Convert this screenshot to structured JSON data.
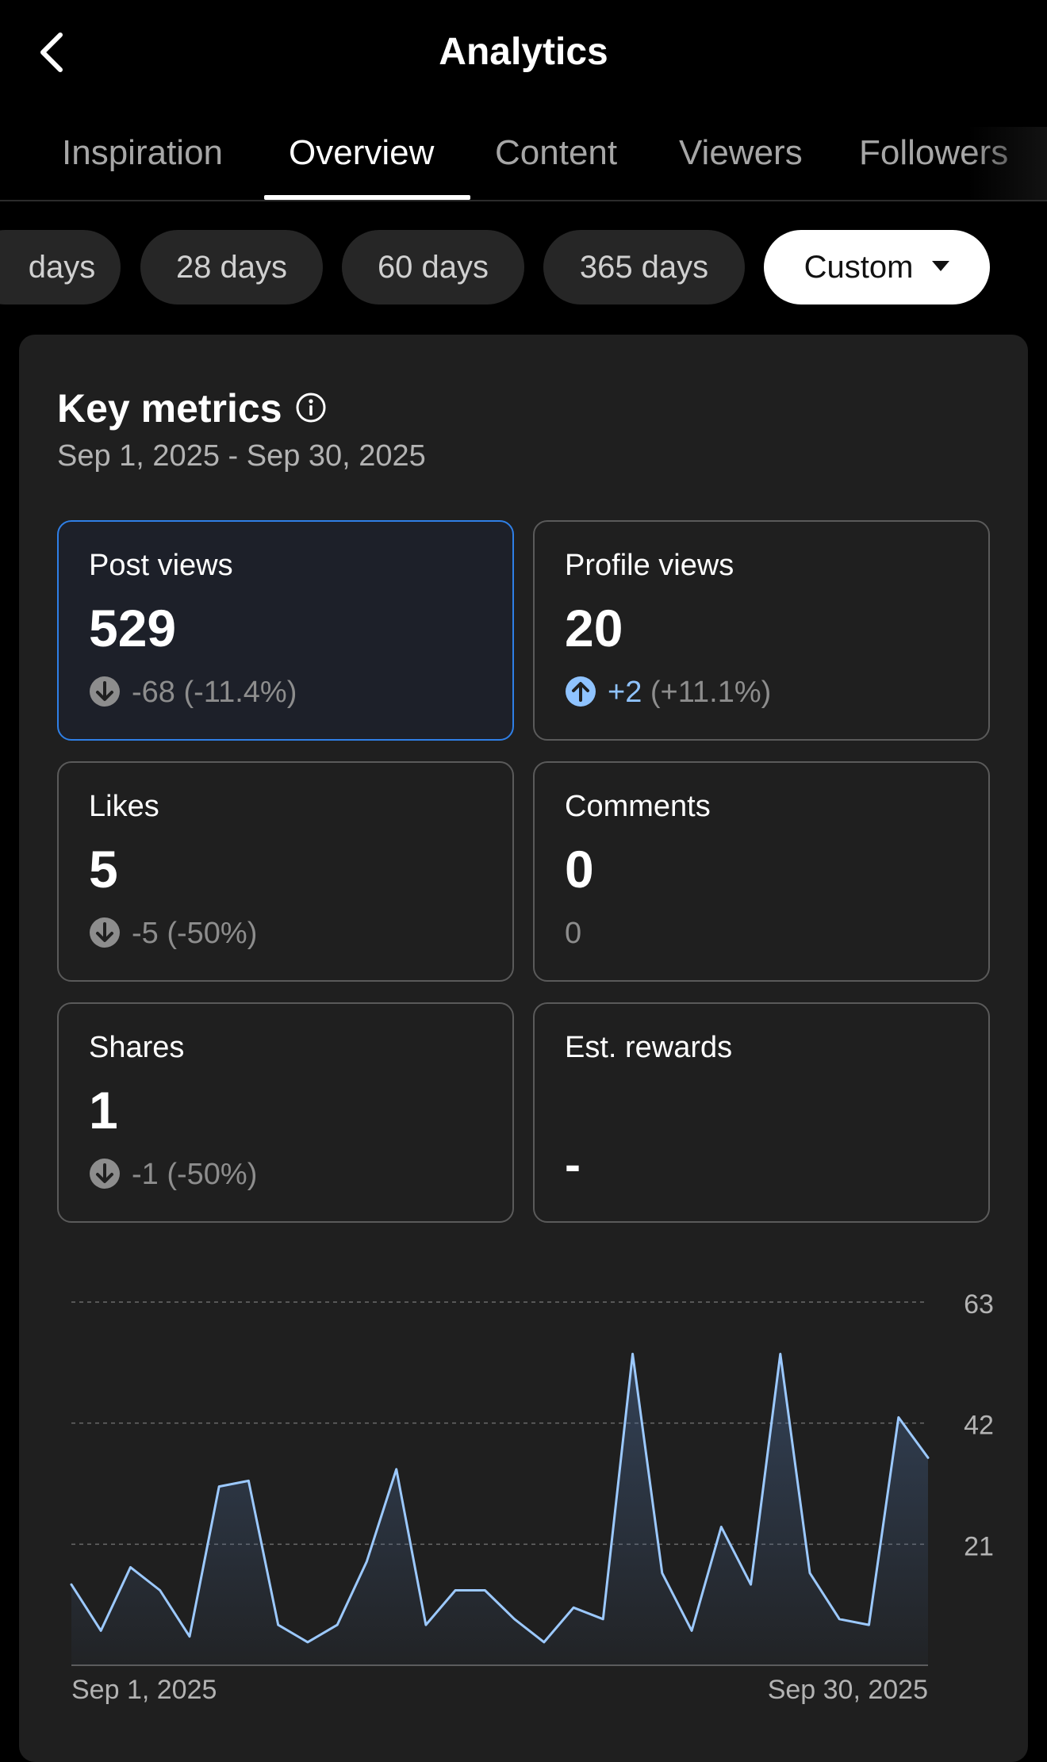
{
  "header": {
    "title": "Analytics"
  },
  "tabs": [
    {
      "label": "Inspiration",
      "active": false
    },
    {
      "label": "Overview",
      "active": true
    },
    {
      "label": "Content",
      "active": false
    },
    {
      "label": "Viewers",
      "active": false
    },
    {
      "label": "Followers",
      "active": false
    }
  ],
  "ranges": [
    {
      "label": "days",
      "selected": false
    },
    {
      "label": "28 days",
      "selected": false
    },
    {
      "label": "60 days",
      "selected": false
    },
    {
      "label": "365 days",
      "selected": false
    },
    {
      "label": "Custom",
      "selected": true
    }
  ],
  "key_metrics": {
    "title": "Key metrics",
    "date_range": "Sep 1, 2025 - Sep 30, 2025",
    "cards": [
      {
        "label": "Post views",
        "value": "529",
        "direction": "down",
        "change": "-68",
        "percent": "(-11.4%)",
        "active": true
      },
      {
        "label": "Profile views",
        "value": "20",
        "direction": "up",
        "change": "+2",
        "percent": "(+11.1%)",
        "active": false
      },
      {
        "label": "Likes",
        "value": "5",
        "direction": "down",
        "change": "-5",
        "percent": "(-50%)",
        "active": false
      },
      {
        "label": "Comments",
        "value": "0",
        "direction": "none",
        "change": "0",
        "percent": "",
        "active": false
      },
      {
        "label": "Shares",
        "value": "1",
        "direction": "down",
        "change": "-1",
        "percent": "(-50%)",
        "active": false
      },
      {
        "label": "Est. rewards",
        "value": "",
        "direction": "none",
        "change": "-",
        "percent": "",
        "active": false
      }
    ]
  },
  "colors": {
    "accent_blue": "#2f7fe6",
    "positive": "#8fc3ff",
    "line": "#9cc9ff",
    "muted": "#8d8d8d"
  },
  "chart_data": {
    "type": "area",
    "title": "",
    "xlabel": "",
    "ylabel": "",
    "x": [
      "Sep 1, 2025",
      "Sep 2, 2025",
      "Sep 3, 2025",
      "Sep 4, 2025",
      "Sep 5, 2025",
      "Sep 6, 2025",
      "Sep 7, 2025",
      "Sep 8, 2025",
      "Sep 9, 2025",
      "Sep 10, 2025",
      "Sep 11, 2025",
      "Sep 12, 2025",
      "Sep 13, 2025",
      "Sep 14, 2025",
      "Sep 15, 2025",
      "Sep 16, 2025",
      "Sep 17, 2025",
      "Sep 18, 2025",
      "Sep 19, 2025",
      "Sep 20, 2025",
      "Sep 21, 2025",
      "Sep 22, 2025",
      "Sep 23, 2025",
      "Sep 24, 2025",
      "Sep 25, 2025",
      "Sep 26, 2025",
      "Sep 27, 2025",
      "Sep 28, 2025",
      "Sep 29, 2025",
      "Sep 30, 2025"
    ],
    "series": [
      {
        "values": [
          14,
          6,
          17,
          13,
          5,
          31,
          32,
          7,
          4,
          7,
          18,
          34,
          7,
          13,
          13,
          8,
          4,
          10,
          8,
          54,
          16,
          6,
          24,
          14,
          54,
          16,
          8,
          7,
          43,
          36
        ]
      }
    ],
    "ylim": [
      0,
      63
    ],
    "yticks": [
      21,
      42,
      63
    ],
    "x_tick_labels": [
      "Sep 1, 2025",
      "Sep 30, 2025"
    ],
    "y_axis_side": "right",
    "grid": true
  }
}
